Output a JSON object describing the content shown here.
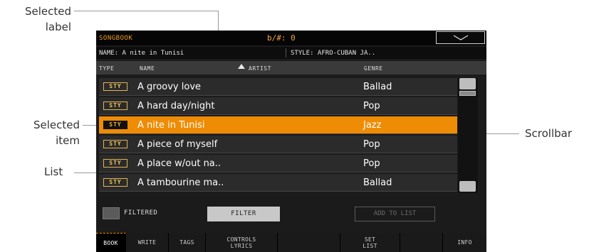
{
  "callouts": {
    "selected_label_line1": "Selected",
    "selected_label_line2": "label",
    "selected_item_line1": "Selected",
    "selected_item_line2": "item",
    "list": "List",
    "scrollbar": "Scrollbar"
  },
  "header": {
    "title": "SONGBOOK",
    "transpose": "b/#: 0"
  },
  "infobar": {
    "name": "NAME: A nite in Tunisi",
    "style": "STYLE: AFRO-CUBAN JA.."
  },
  "columns": {
    "type": "TYPE",
    "name": "NAME",
    "artist": "ARTIST",
    "genre": "GENRE"
  },
  "rows": [
    {
      "type": "STY",
      "name": "A groovy love",
      "genre": "Ballad"
    },
    {
      "type": "STY",
      "name": "A hard day/night",
      "genre": "Pop"
    },
    {
      "type": "STY",
      "name": "A nite in Tunisi",
      "genre": "Jazz"
    },
    {
      "type": "STY",
      "name": "A piece of myself",
      "genre": "Pop"
    },
    {
      "type": "STY",
      "name": "A place w/out na..",
      "genre": "Pop"
    },
    {
      "type": "STY",
      "name": "A tambourine ma..",
      "genre": "Ballad"
    }
  ],
  "selected_row_index": 2,
  "controls": {
    "filtered_label": "FILTERED",
    "filter_button": "FILTER",
    "add_to_list_button": "ADD TO LIST"
  },
  "tabs": [
    {
      "line1": "BOOK",
      "line2": ""
    },
    {
      "line1": "WRITE",
      "line2": ""
    },
    {
      "line1": "TAGS",
      "line2": ""
    },
    {
      "line1": "CONTROLS",
      "line2": "LYRICS"
    },
    {
      "line1": "SET",
      "line2": "LIST"
    },
    {
      "line1": "INFO",
      "line2": ""
    }
  ],
  "icons": {
    "dropdown": "chevron-down-icon",
    "sort": "sort-ascending-icon"
  },
  "colors": {
    "accent": "#ee8c05",
    "title_text": "#f29a1f",
    "badge": "#e2b552"
  }
}
